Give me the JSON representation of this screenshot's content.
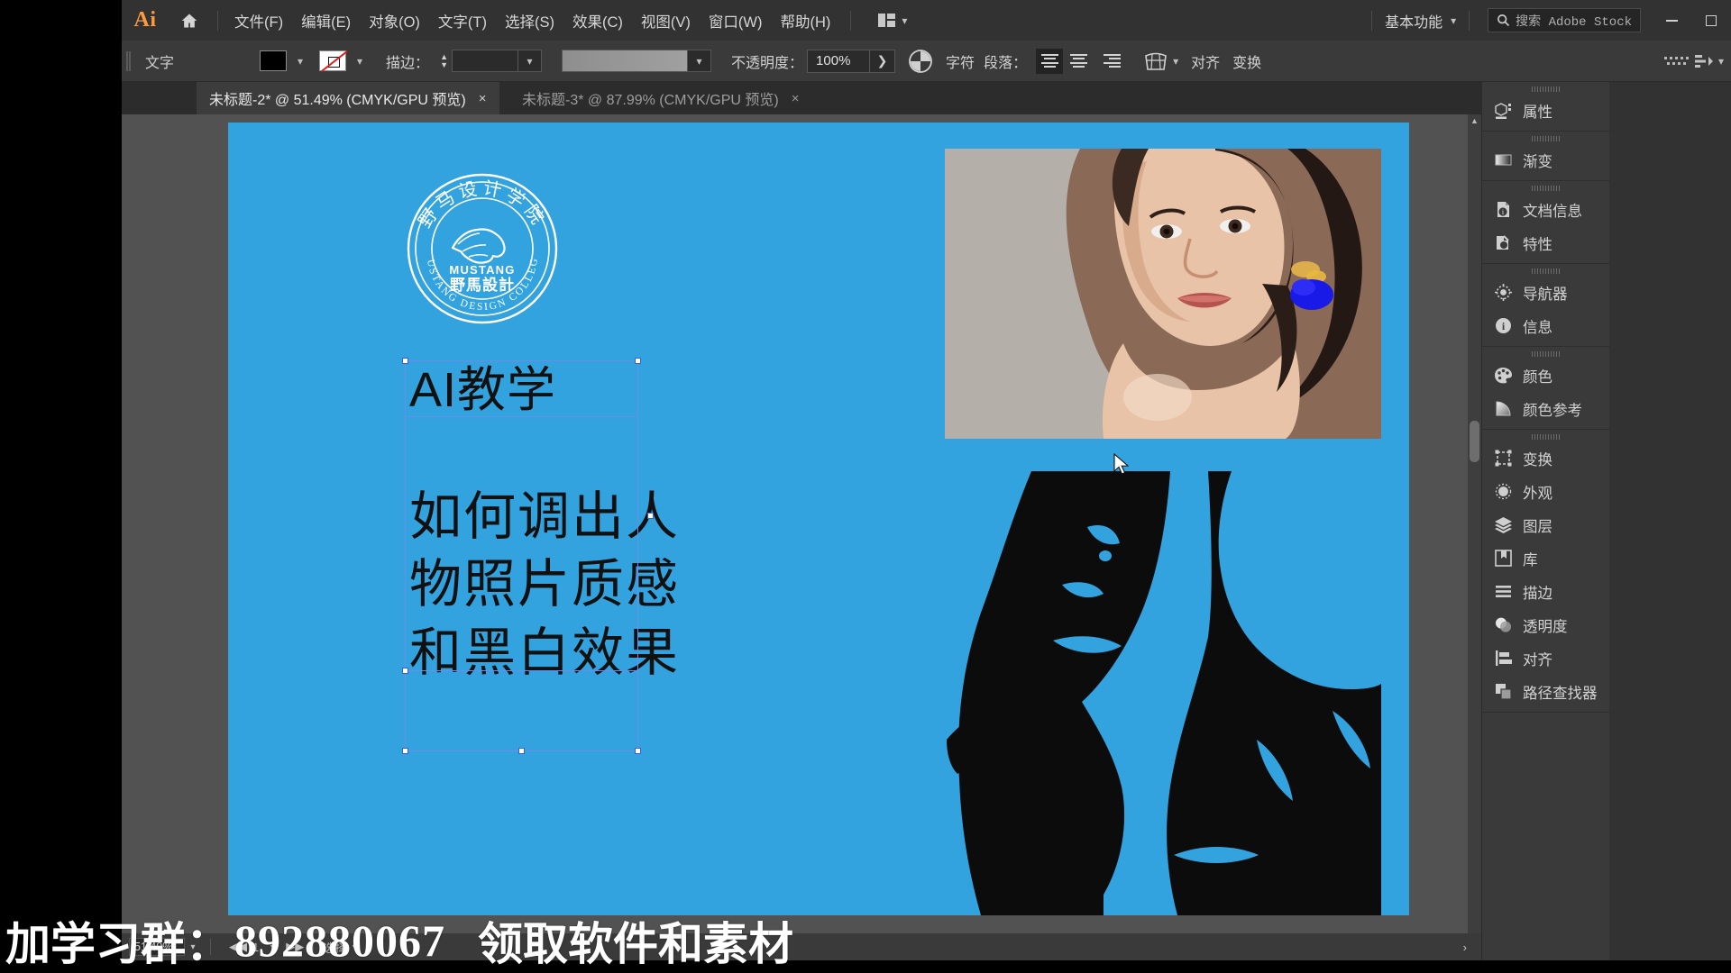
{
  "app": {
    "logo": "Ai",
    "home_icon": "home-icon"
  },
  "menubar": {
    "items": [
      {
        "label": "文件(F)",
        "name": "menu-file"
      },
      {
        "label": "编辑(E)",
        "name": "menu-edit"
      },
      {
        "label": "对象(O)",
        "name": "menu-object"
      },
      {
        "label": "文字(T)",
        "name": "menu-type"
      },
      {
        "label": "选择(S)",
        "name": "menu-select"
      },
      {
        "label": "效果(C)",
        "name": "menu-effect"
      },
      {
        "label": "视图(V)",
        "name": "menu-view"
      },
      {
        "label": "窗口(W)",
        "name": "menu-window"
      },
      {
        "label": "帮助(H)",
        "name": "menu-help"
      }
    ],
    "arrange_documents_icon": "arrange-documents-icon",
    "workspace": "基本功能",
    "search_placeholder": "搜索 Adobe Stock",
    "search_value": "",
    "search_cn": "搜索",
    "search_en": "Adobe Stock",
    "window_minimize": "minimize-icon",
    "window_maximize": "maximize-icon"
  },
  "controlbar": {
    "context_label": "文字",
    "fill_color": "#000000",
    "stroke_color": "none",
    "stroke_label": "描边：",
    "stroke_weight": "",
    "gradient_value": "",
    "opacity_label": "不透明度：",
    "opacity_value": "100%",
    "recolor_icon": "recolor-artwork-icon",
    "character_label": "字符",
    "paragraph_label": "段落：",
    "align_left": "align-left-icon",
    "align_center": "align-center-icon",
    "align_right": "align-right-icon",
    "envelope_icon": "envelope-distort-icon",
    "align_link": "对齐",
    "transform_link": "变换"
  },
  "tabs": [
    {
      "label": "未标题-2* @ 51.49% (CMYK/GPU 预览)",
      "active": true,
      "close": "×"
    },
    {
      "label": "未标题-3* @ 87.99% (CMYK/GPU 预览)",
      "active": false,
      "close": "×"
    }
  ],
  "toolbar": {
    "collapse_icon": "collapse-panel-icon",
    "tools": [
      {
        "name": "selection-tool",
        "selected": true
      },
      {
        "name": "direct-selection-tool",
        "selected": false
      },
      {
        "name": "magic-wand-tool",
        "selected": false
      },
      {
        "name": "lasso-tool",
        "selected": false
      },
      {
        "name": "pen-tool",
        "selected": false
      },
      {
        "name": "curvature-tool",
        "selected": false
      },
      {
        "name": "type-tool",
        "selected": false
      },
      {
        "name": "line-segment-tool",
        "selected": false
      },
      {
        "name": "rectangle-tool",
        "selected": false
      },
      {
        "name": "paintbrush-tool",
        "selected": false
      },
      {
        "name": "shaper-tool",
        "selected": false
      },
      {
        "name": "eraser-tool",
        "selected": false
      },
      {
        "name": "rotate-tool",
        "selected": false
      },
      {
        "name": "scale-tool",
        "selected": false
      },
      {
        "name": "scissors-tool",
        "selected": false
      },
      {
        "name": "free-transform-tool",
        "selected": false
      },
      {
        "name": "shape-builder-tool",
        "selected": false
      },
      {
        "name": "perspective-grid-tool",
        "selected": false
      },
      {
        "name": "mesh-tool",
        "selected": false
      },
      {
        "name": "gradient-tool",
        "selected": false
      },
      {
        "name": "eyedropper-tool",
        "selected": false
      },
      {
        "name": "blend-tool",
        "selected": false
      },
      {
        "name": "symbol-sprayer-tool",
        "selected": false
      },
      {
        "name": "column-graph-tool",
        "selected": false
      },
      {
        "name": "artboard-tool",
        "selected": false
      },
      {
        "name": "slice-tool",
        "selected": false
      },
      {
        "name": "hand-tool",
        "selected": false
      },
      {
        "name": "zoom-tool",
        "selected": false
      }
    ],
    "fill_swatch": "#0c0c0c",
    "stroke_swatch": "none",
    "swap_fill_stroke_icon": "swap-fill-stroke-icon",
    "default_fill_stroke_icon": "default-fill-stroke-icon",
    "color_mode": "color-mode-icon",
    "gradient_mode": "gradient-mode-icon",
    "none_mode": "none-mode-icon",
    "draw_normal": "draw-normal-icon",
    "draw_behind": "draw-behind-icon",
    "draw_inside": "draw-inside-icon",
    "screen_mode_icon": "change-screen-mode-icon",
    "more_tools": "⋯"
  },
  "canvas": {
    "artboard_color": "#33a3e0",
    "logo": {
      "cn_top": "野马设计学院",
      "en_bottom": "MUSTANG DESIGN COLLEGE",
      "brand_en": "MUSTANG",
      "brand_cn": "野馬設計"
    },
    "text_title": "AI教学",
    "text_body_lines": [
      "如何调出人",
      "物照片质感",
      "和黑白效果"
    ],
    "cursor": "selection-cursor"
  },
  "statusbar": {
    "zoom_value": "51.49%",
    "artboard_nav_first": "◀◀",
    "artboard_index": "1",
    "tool_label": "选择"
  },
  "rightdock": {
    "groups": [
      {
        "items": [
          {
            "label": "属性",
            "icon": "properties-icon"
          }
        ]
      },
      {
        "items": [
          {
            "label": "渐变",
            "icon": "gradient-icon"
          }
        ]
      },
      {
        "items": [
          {
            "label": "文档信息",
            "icon": "document-info-icon"
          },
          {
            "label": "特性",
            "icon": "attributes-icon"
          }
        ]
      },
      {
        "items": [
          {
            "label": "导航器",
            "icon": "navigator-icon"
          },
          {
            "label": "信息",
            "icon": "info-icon"
          }
        ]
      },
      {
        "items": [
          {
            "label": "颜色",
            "icon": "color-icon"
          },
          {
            "label": "颜色参考",
            "icon": "color-guide-icon"
          }
        ]
      },
      {
        "items": [
          {
            "label": "变换",
            "icon": "transform-icon"
          },
          {
            "label": "外观",
            "icon": "appearance-icon"
          },
          {
            "label": "图层",
            "icon": "layers-icon"
          },
          {
            "label": "库",
            "icon": "libraries-icon"
          },
          {
            "label": "描边",
            "icon": "stroke-icon"
          },
          {
            "label": "透明度",
            "icon": "transparency-icon"
          },
          {
            "label": "对齐",
            "icon": "align-icon"
          },
          {
            "label": "路径查找器",
            "icon": "pathfinder-icon"
          }
        ]
      }
    ]
  },
  "caption": {
    "prefix": "加学习群：",
    "qq": "892880067",
    "suffix": "领取软件和素材"
  }
}
